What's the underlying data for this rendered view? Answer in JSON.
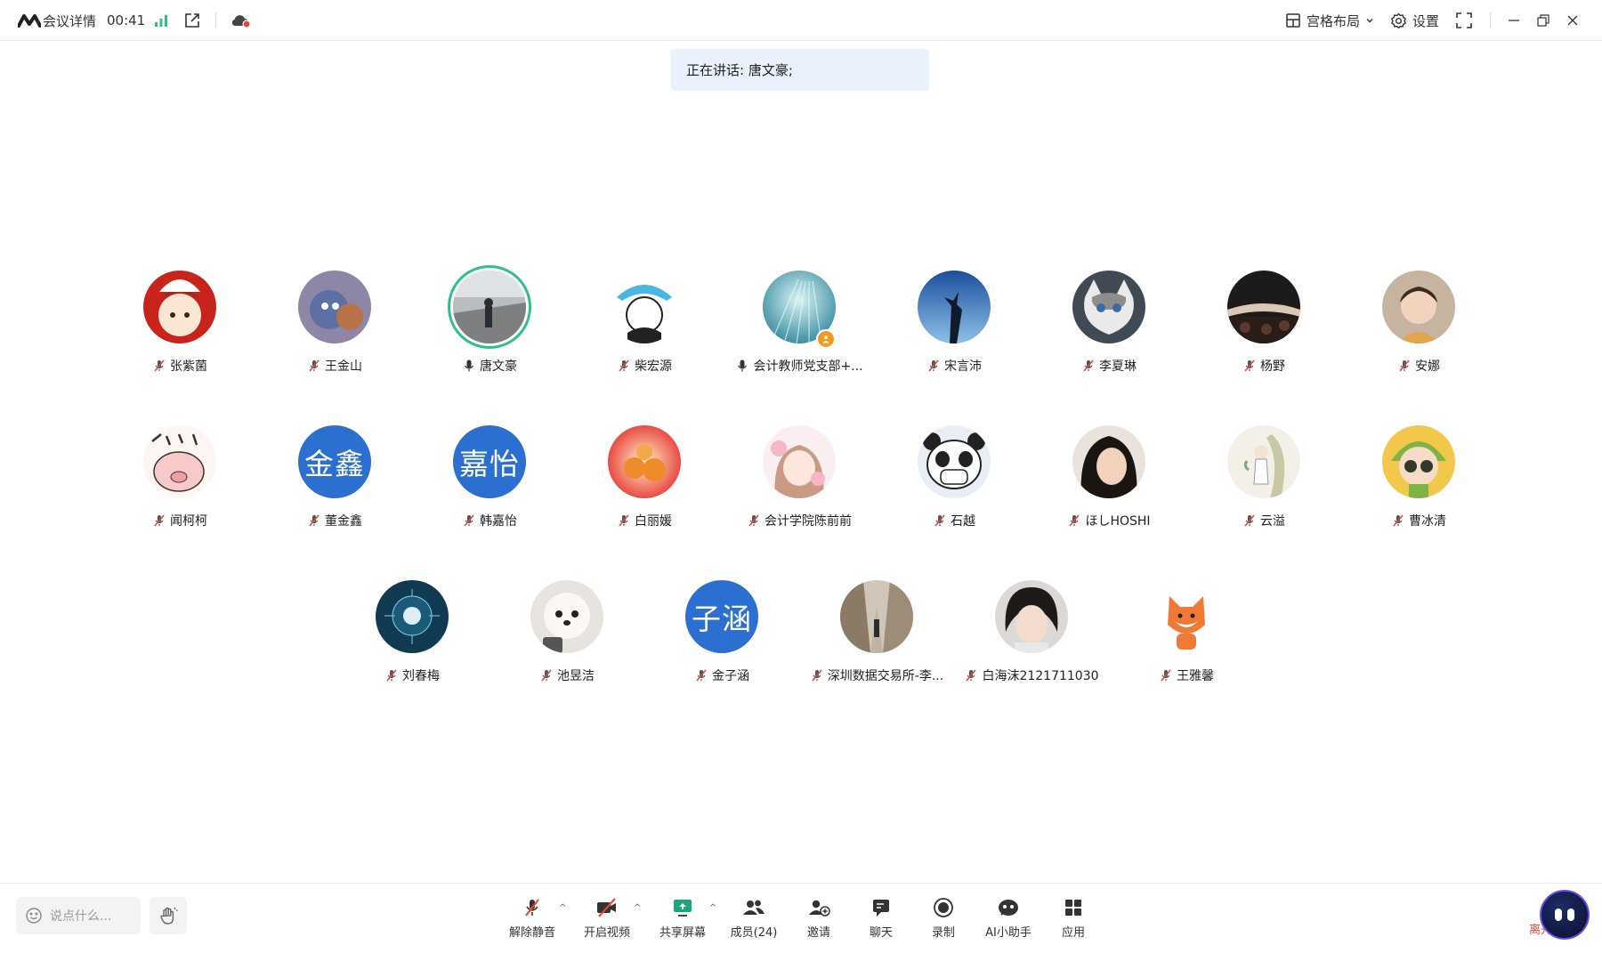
{
  "topbar": {
    "meeting_info": "会议详情",
    "timer": "00:41",
    "layout_label": "宫格布局",
    "settings_label": "设置"
  },
  "speaking": {
    "text": "正在讲话: 唐文豪;"
  },
  "participants": [
    {
      "name": "张紫菌",
      "mic": "muted"
    },
    {
      "name": "王金山",
      "mic": "muted"
    },
    {
      "name": "唐文豪",
      "mic": "on",
      "speaking": true
    },
    {
      "name": "柴宏源",
      "mic": "muted"
    },
    {
      "name": "会计教师党支部+...",
      "mic": "on",
      "host": true
    },
    {
      "name": "宋言沛",
      "mic": "muted"
    },
    {
      "name": "李夏琳",
      "mic": "muted"
    },
    {
      "name": "杨野",
      "mic": "muted"
    },
    {
      "name": "安娜",
      "mic": "muted"
    },
    {
      "name": "闻柯柯",
      "mic": "muted"
    },
    {
      "name": "董金鑫",
      "mic": "muted",
      "avatar_text": "金鑫"
    },
    {
      "name": "韩嘉怡",
      "mic": "muted",
      "avatar_text": "嘉怡"
    },
    {
      "name": "白丽媛",
      "mic": "muted"
    },
    {
      "name": "会计学院陈前前",
      "mic": "muted"
    },
    {
      "name": "石越",
      "mic": "muted"
    },
    {
      "name": "ほしHOSHI",
      "mic": "muted"
    },
    {
      "name": "云溢",
      "mic": "muted"
    },
    {
      "name": "曹冰清",
      "mic": "muted"
    },
    {
      "name": "刘春梅",
      "mic": "muted"
    },
    {
      "name": "池昱洁",
      "mic": "muted"
    },
    {
      "name": "金子涵",
      "mic": "muted",
      "avatar_text": "子涵"
    },
    {
      "name": "深圳数据交易所-李...",
      "mic": "muted"
    },
    {
      "name": "白海沫2121711030",
      "mic": "muted"
    },
    {
      "name": "王雅馨",
      "mic": "muted"
    }
  ],
  "bottombar": {
    "chat_placeholder": "说点什么...",
    "unmute": "解除静音",
    "start_video": "开启视频",
    "share_screen": "共享屏幕",
    "members": "成员(24)",
    "invite": "邀请",
    "chat": "聊天",
    "record": "录制",
    "ai_assistant": "AI小助手",
    "apps": "应用",
    "leave": "离开"
  },
  "colors": {
    "accent_blue": "#2b6fd1",
    "speaking_ring": "#2fbf8a",
    "mute_red": "#e8453c",
    "host_badge": "#f39a1e",
    "banner_bg": "#eaf1fc"
  }
}
